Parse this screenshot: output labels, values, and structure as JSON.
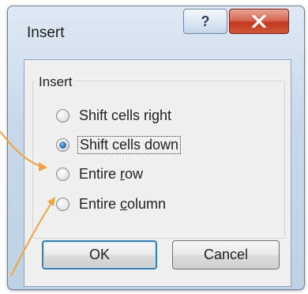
{
  "window": {
    "title": "Insert",
    "help_glyph": "?",
    "close_glyph": "X"
  },
  "group": {
    "label": "Insert"
  },
  "options": [
    {
      "label": "Shift cells right",
      "checked": false
    },
    {
      "label": "Shift cells down",
      "checked": true
    },
    {
      "label": "Entire row",
      "checked": false
    },
    {
      "label": "Entire column",
      "checked": false
    }
  ],
  "buttons": {
    "ok": "OK",
    "cancel": "Cancel"
  },
  "colors": {
    "annotation_arrow": "#f3a23a",
    "close_button": "#c8432a",
    "title_frame": "#c9d9ea"
  }
}
